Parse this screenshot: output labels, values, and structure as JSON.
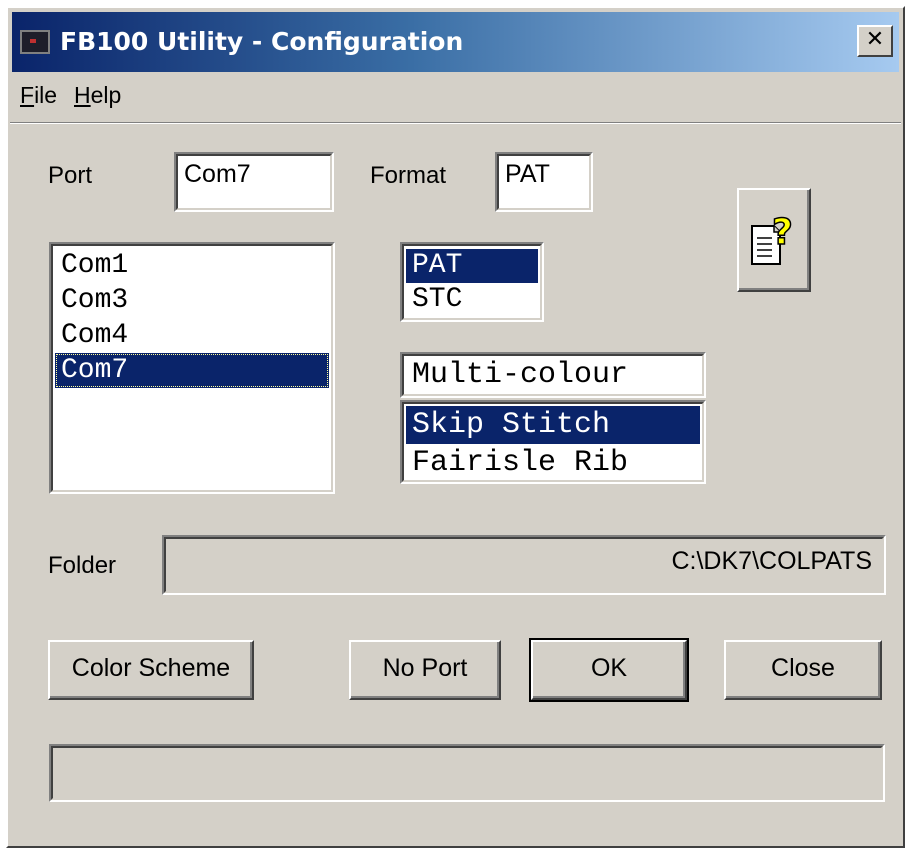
{
  "window": {
    "title": "FB100 Utility - Configuration",
    "close_glyph": "✕"
  },
  "menu": {
    "file": {
      "accel": "F",
      "rest": "ile"
    },
    "help": {
      "accel": "H",
      "rest": "elp"
    }
  },
  "port": {
    "label": "Port",
    "value": "Com7",
    "options": [
      "Com1",
      "Com3",
      "Com4",
      "Com7"
    ],
    "selected": "Com7"
  },
  "format": {
    "label": "Format",
    "value": "PAT",
    "options": [
      "PAT",
      "STC"
    ],
    "selected": "PAT"
  },
  "pattern_mode": {
    "current": "Multi-colour",
    "options": [
      "Skip Stitch",
      "Fairisle Rib"
    ],
    "selected": "Skip Stitch"
  },
  "help_icon": "help-document-question-icon",
  "folder": {
    "label": "Folder",
    "value": "C:\\DK7\\COLPATS"
  },
  "buttons": {
    "color_scheme": "Color Scheme",
    "no_port": "No Port",
    "ok": "OK",
    "close": "Close"
  },
  "status": {
    "text": ""
  },
  "colors": {
    "face": "#d4d0c8",
    "selection": "#0a246a",
    "title_start": "#0a246a",
    "title_end": "#a6caf0"
  }
}
